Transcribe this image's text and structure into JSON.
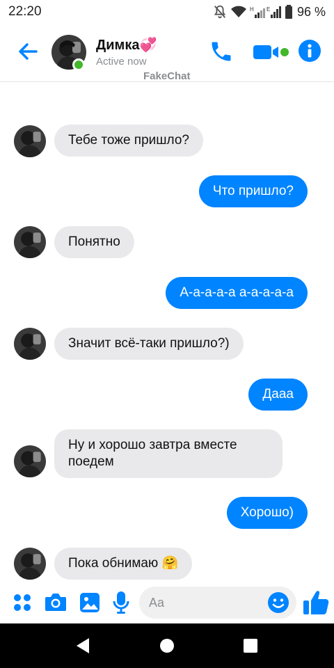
{
  "status_bar": {
    "time": "22:20",
    "battery": "96 %",
    "icons": [
      "bell-off-icon",
      "wifi-icon",
      "signal-icon",
      "battery-icon"
    ]
  },
  "header": {
    "contact_name": "Димка",
    "name_emoji": "💞",
    "status": "Active now",
    "watermark": "FakeChat",
    "accent_color": "#0084ff",
    "online_color": "#42b72a"
  },
  "messages": [
    {
      "from": "them",
      "text": "Тебе тоже пришло?"
    },
    {
      "from": "me",
      "text": "Что пришло?"
    },
    {
      "from": "them",
      "text": "Понятно"
    },
    {
      "from": "me",
      "text": "А-а-а-а-а а-а-а-а-а"
    },
    {
      "from": "them",
      "text": "Значит всё-таки пришло?)"
    },
    {
      "from": "me",
      "text": "Дааа"
    },
    {
      "from": "them",
      "text": "Ну и хорошо завтра вместе поедем"
    },
    {
      "from": "me",
      "text": "Хорошо)"
    },
    {
      "from": "them",
      "text": "Пока обнимаю 🤗"
    }
  ],
  "composer": {
    "placeholder": "Aa",
    "icons": [
      "apps-icon",
      "camera-icon",
      "gallery-icon",
      "microphone-icon",
      "emoji-icon",
      "thumbs-up-icon"
    ]
  },
  "nav_bar": {
    "icons": [
      "back-triangle-icon",
      "home-circle-icon",
      "recents-square-icon"
    ]
  }
}
